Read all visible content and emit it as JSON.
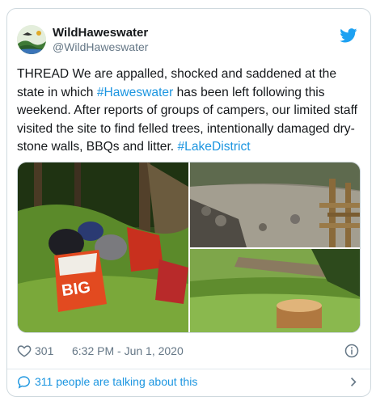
{
  "user": {
    "display_name": "WildHaweswater",
    "handle": "@WildHaweswater",
    "avatar_icon": "wildhaweswater-logo"
  },
  "brand": {
    "icon": "twitter-bird-icon",
    "color": "#1da1f2"
  },
  "tweet": {
    "text_before": "THREAD We are appalled, shocked and saddened at the state in which ",
    "hashtag_1": "#Haweswater",
    "text_middle": " has been left following this weekend. After reports of groups of campers, our limited staff visited the site to find felled trees, intentionally damaged dry-stone walls, BBQs and litter. ",
    "hashtag_2": "#LakeDistrict",
    "link_color": "#1b95e0"
  },
  "media": {
    "photos": [
      {
        "subject": "litter bags in woodland",
        "bag_text": "BIG"
      },
      {
        "subject": "damaged dry-stone wall and wooden fence"
      },
      {
        "subject": "felled tree stump"
      }
    ]
  },
  "meta": {
    "likes": "301",
    "timestamp": "6:32 PM - Jun 1, 2020",
    "like_icon": "heart-icon",
    "info_icon": "info-icon"
  },
  "footer": {
    "text": "311 people are talking about this",
    "icon": "speech-bubble-icon",
    "chevron": "chevron-right-icon"
  }
}
